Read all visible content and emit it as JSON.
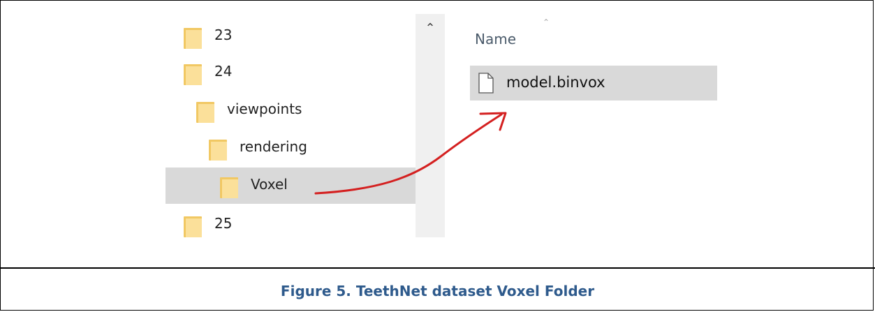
{
  "tree": {
    "items": [
      {
        "label": "23",
        "indent": 0,
        "selected": false
      },
      {
        "label": "24",
        "indent": 0,
        "selected": false
      },
      {
        "label": "viewpoints",
        "indent": 1,
        "selected": false
      },
      {
        "label": "rendering",
        "indent": 2,
        "selected": false
      },
      {
        "label": "Voxel",
        "indent": 3,
        "selected": true
      },
      {
        "label": "25",
        "indent": 0,
        "selected": false
      }
    ]
  },
  "list": {
    "column_header": "Name",
    "files": [
      {
        "label": "model.binvox",
        "selected": true
      }
    ]
  },
  "caption": "Figure  5. TeethNet dataset Voxel Folder",
  "colors": {
    "selection": "#d9d9d9",
    "folder": "#f1c863",
    "arrow": "#d42020",
    "caption": "#2e5a8c"
  }
}
